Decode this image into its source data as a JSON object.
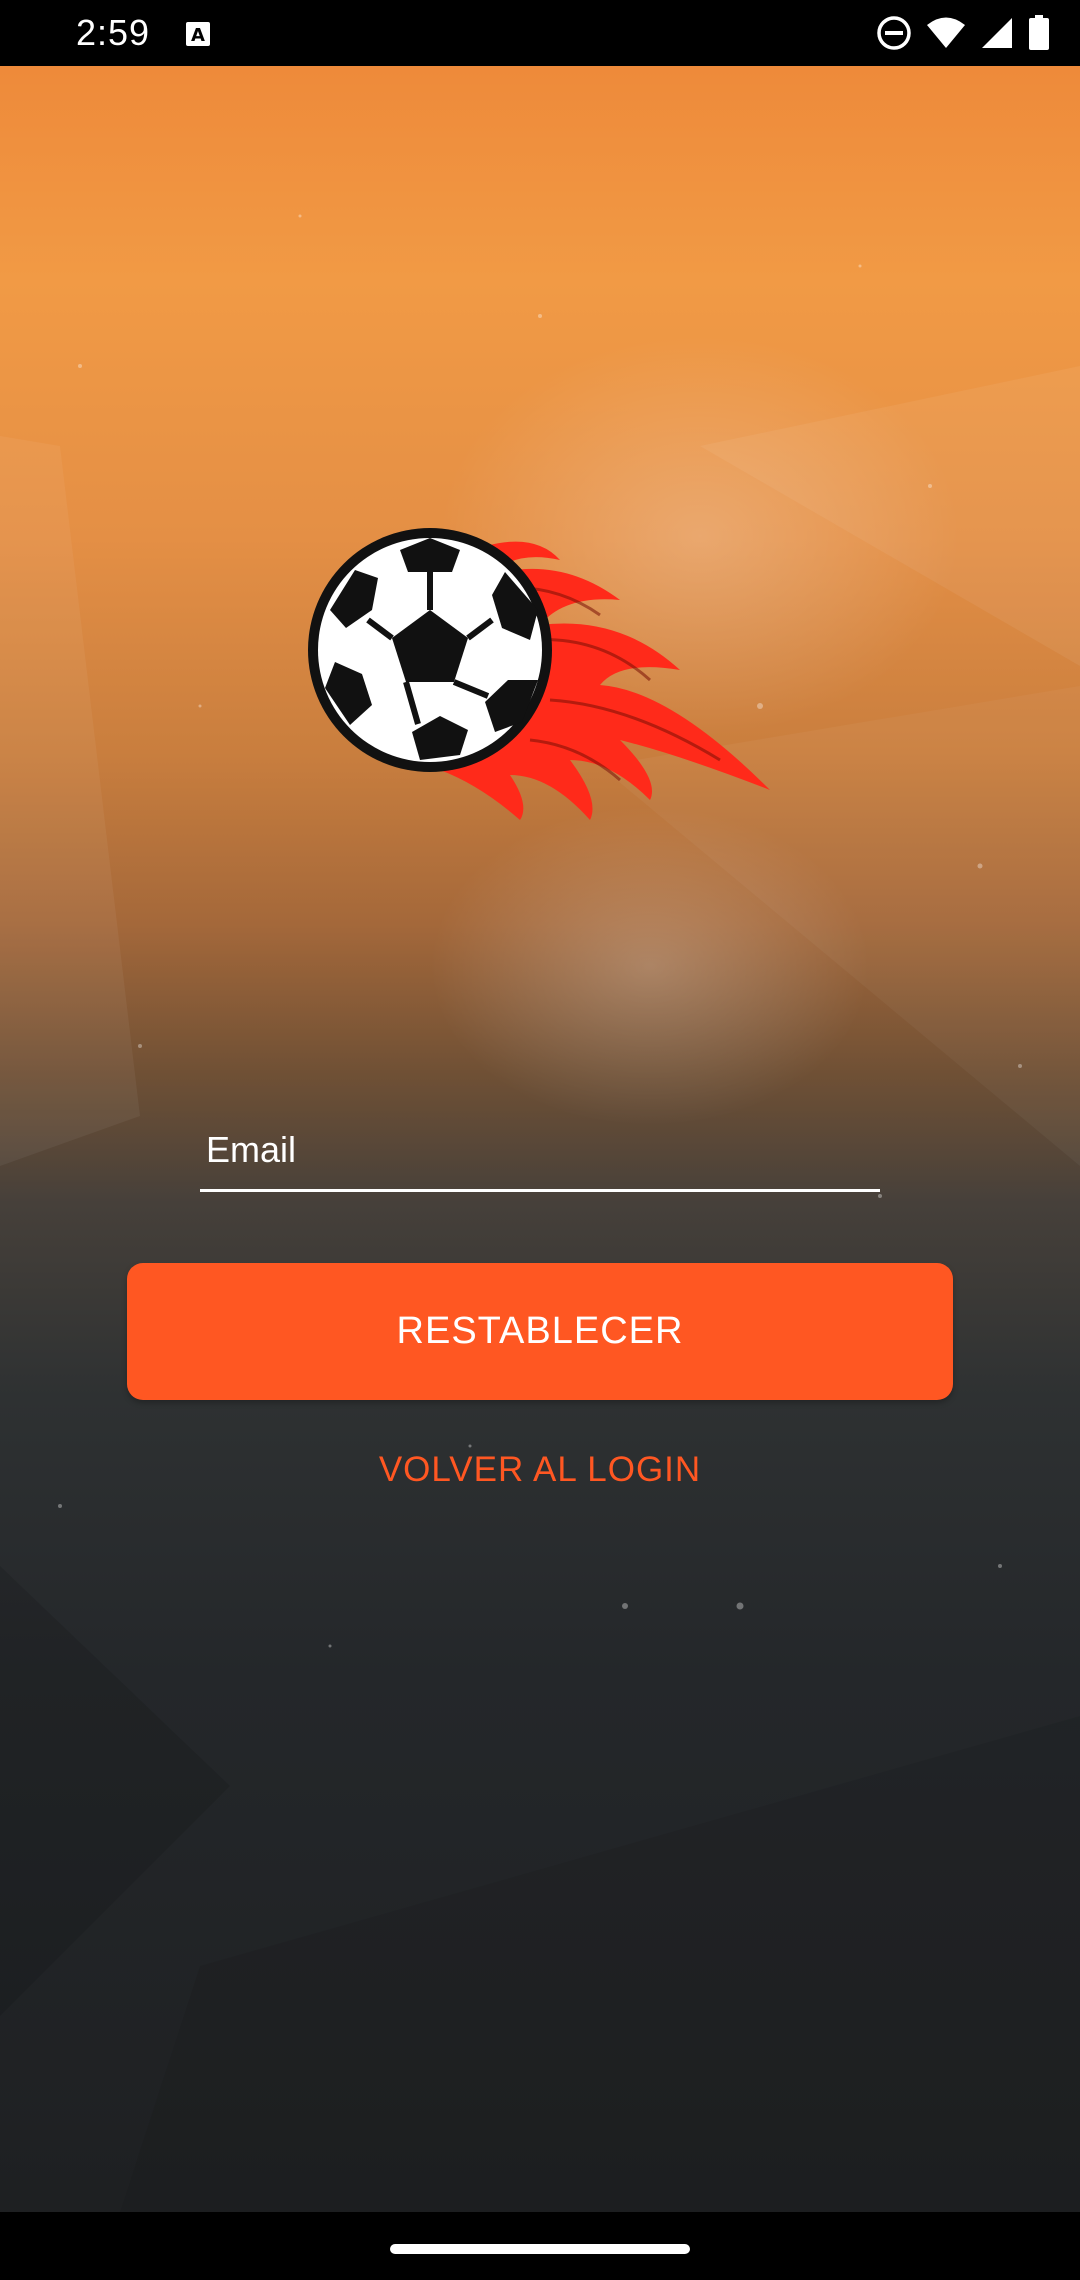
{
  "status_bar": {
    "time": "2:59",
    "icons": [
      "font-notification-icon",
      "do-not-disturb-icon",
      "wifi-icon",
      "cellular-signal-icon",
      "battery-icon"
    ]
  },
  "logo": {
    "icon": "flaming-soccer-ball-icon",
    "colors": {
      "ball_white": "#ffffff",
      "ball_black": "#111111",
      "flame": "#ff2a1a"
    }
  },
  "form": {
    "email_placeholder": "Email",
    "email_value": "",
    "reset_label": "RESTABLECER",
    "back_label": "VOLVER AL LOGIN"
  },
  "colors": {
    "accent": "#ff5722",
    "status_bar": "#000000",
    "text_light": "#ffffff"
  }
}
